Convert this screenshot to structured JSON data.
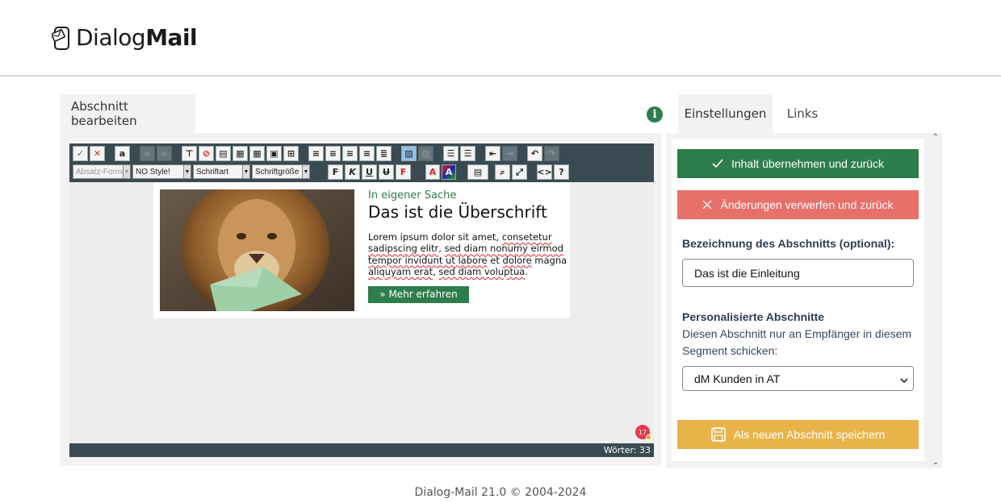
{
  "header": {
    "logo_light": "Dialog",
    "logo_bold": "Mail",
    "logo_icon": "phone-letter-icon"
  },
  "left": {
    "tab_label": "Abschnitt bearbeiten"
  },
  "editor": {
    "paragraph_format": "Absatz-Format",
    "style": "NO Style!",
    "font": "Schriftart",
    "font_size": "Schriftgröße",
    "bold": "F",
    "italic": "K",
    "underline": "U",
    "strike": "U",
    "font_color": "A",
    "bg_color": "A",
    "source": "<>",
    "help": "?",
    "word_count": "Wörter: 33",
    "badge_count": "17"
  },
  "mail": {
    "kicker": "In eigener Sache",
    "headline": "Das ist die Überschrift",
    "body_parts": [
      "Lorem ipsum dolor sit amet, ",
      "consetetur sadipscing elitr",
      ", ",
      "sed diam nonumy eirmod tempor invidunt ut labore",
      " et ",
      "dolore",
      " magna ",
      "aliquyam erat",
      ", ",
      "sed diam voluptua",
      "."
    ],
    "button": "» Mehr erfahren"
  },
  "right": {
    "tab_settings": "Einstellungen",
    "tab_links": "Links",
    "info": "i",
    "apply_button": "Inhalt übernehmen und zurück",
    "discard_button": "Änderungen verwerfen und zurück",
    "name_label": "Bezeichnung des Abschnitts (optional):",
    "name_value": "Das ist die Einleitung",
    "personal_title": "Personalisierte Abschnitte",
    "personal_desc_1": "Diesen Abschnitt nur an Empfänger in diesem",
    "personal_desc_2": "Segment schicken:",
    "segment_value": "dM Kunden in AT",
    "save_button": "Als neuen Abschnitt speichern"
  },
  "footer": {
    "text": "Dialog-Mail 21.0 © 2004-2024"
  },
  "colors": {
    "primary": "#2e7d4c",
    "danger": "#e8706b",
    "warning": "#e8b44a",
    "toolbar": "#3a4a52"
  }
}
